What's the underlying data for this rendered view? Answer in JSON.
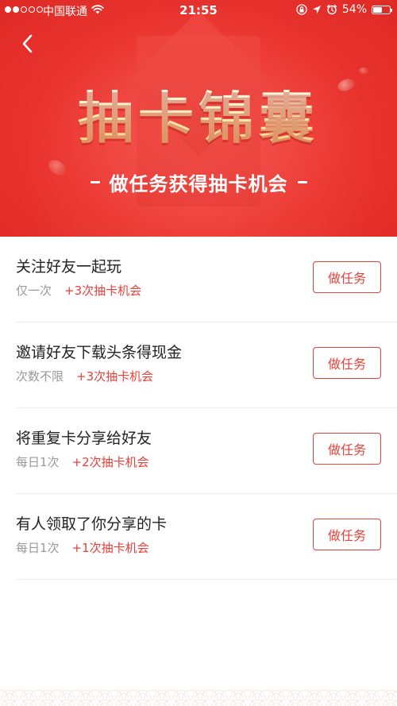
{
  "status_bar": {
    "carrier": "中国联通",
    "time": "21:55",
    "battery": "54%",
    "battery_level": 0.54,
    "signal_bars": 2,
    "icons": [
      "wifi-icon",
      "screen-lock-icon",
      "location-icon",
      "alarm-icon",
      "battery-icon"
    ]
  },
  "header": {
    "back_icon": "chevron-left-icon",
    "title": "抽卡锦囊",
    "subtitle": "做任务获得抽卡机会"
  },
  "tasks": [
    {
      "title": "关注好友一起玩",
      "frequency": "仅一次",
      "reward": "+3次抽卡机会",
      "button": "做任务"
    },
    {
      "title": "邀请好友下载头条得现金",
      "frequency": "次数不限",
      "reward": "+3次抽卡机会",
      "button": "做任务"
    },
    {
      "title": "将重复卡分享给好友",
      "frequency": "每日1次",
      "reward": "+2次抽卡机会",
      "button": "做任务"
    },
    {
      "title": "有人领取了你分享的卡",
      "frequency": "每日1次",
      "reward": "+1次抽卡机会",
      "button": "做任务"
    }
  ],
  "colors": {
    "banner": "#e9332e",
    "accent": "#e8403a",
    "title_gold": "#ffe8ae",
    "muted_text": "#999999"
  }
}
